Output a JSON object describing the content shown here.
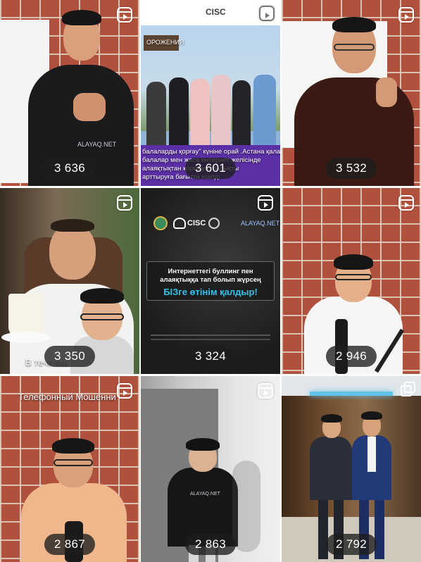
{
  "tiles": [
    {
      "views": "3 636",
      "icon": "reels-icon",
      "caption": "ALAYAQ.NET"
    },
    {
      "views": "3 601",
      "icon": "reels-icon",
      "caption_top": "CISC",
      "caption_sign": "ОРОЖЕНИЯ",
      "caption_bottom_1": "балаларды қорғау\" күніне орай .Астана қалас",
      "caption_bottom_2": "балалар мен жасө         интернет желісінде",
      "caption_bottom_3": "алаяқтықтан қорға         уаттылықты",
      "caption_bottom_4": "арттыруға бағытта          кізілді"
    },
    {
      "views": "3 532",
      "icon": "reels-icon"
    },
    {
      "views": "3 350",
      "icon": "reels-icon",
      "caption": "В тече         мы"
    },
    {
      "views": "3 324",
      "icon": "reels-icon",
      "logo_text": "CISC",
      "brand": "ALAYAQ.NET",
      "headline": "Интернеттегі буллинг пен алаяқтыққа тап болып жүрсең",
      "cta": "БІЗге өтінім қалдыр!"
    },
    {
      "views": "2 946",
      "icon": "reels-icon"
    },
    {
      "views": "2 867",
      "icon": "reels-icon",
      "caption": "Телефонный Мошенни"
    },
    {
      "views": "2 863",
      "icon": "reels-icon",
      "caption": "ALAYAQ.NET"
    },
    {
      "views": "2 792",
      "icon": "carousel-icon"
    }
  ]
}
